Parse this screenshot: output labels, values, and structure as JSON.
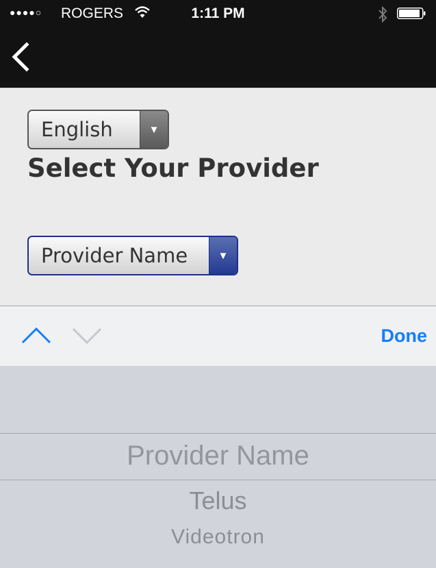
{
  "status_bar": {
    "signal": "●●●●○",
    "carrier": "ROGERS",
    "time": "1:11 PM",
    "wifi_icon": "wifi-icon",
    "bluetooth_icon": "bluetooth-icon",
    "battery_icon": "battery-icon",
    "battery_level_percent": 90
  },
  "nav": {
    "back_icon": "chevron-left-icon"
  },
  "form": {
    "language_select": {
      "value": "English",
      "arrow": "▼"
    },
    "heading": "Select Your Provider",
    "provider_select": {
      "value": "Provider Name",
      "arrow": "▼"
    }
  },
  "toolbar": {
    "prev_icon": "chevron-up-icon",
    "next_icon": "chevron-down-icon",
    "done_label": "Done",
    "accent_color": "#157efb"
  },
  "picker": {
    "selected": "Provider Name",
    "options": [
      "Provider Name",
      "Telus",
      "Videotron"
    ]
  }
}
